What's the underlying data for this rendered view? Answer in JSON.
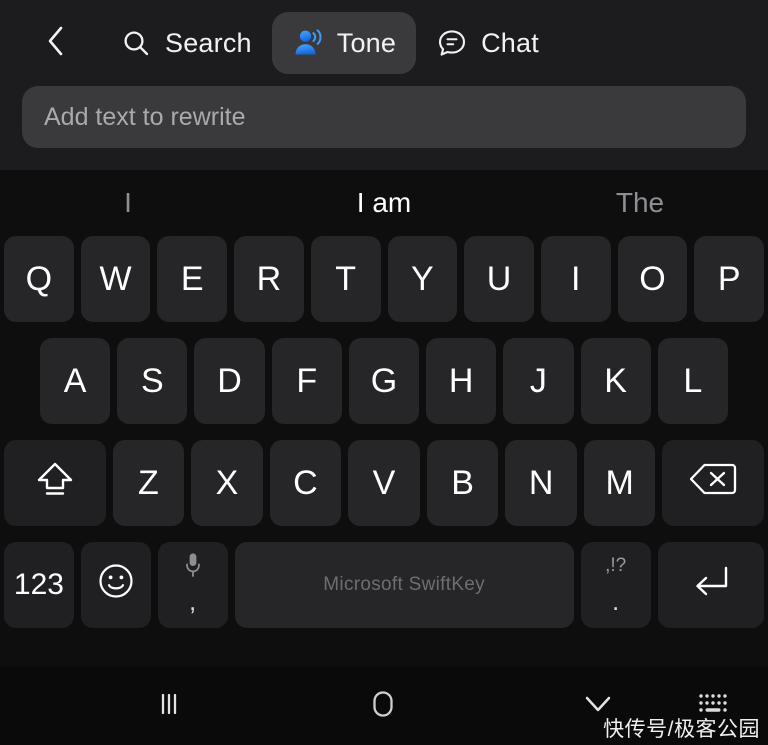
{
  "toolbar": {
    "back_icon": "chevron-left-icon",
    "items": [
      {
        "label": "Search",
        "icon": "search-icon",
        "active": false
      },
      {
        "label": "Tone",
        "icon": "tone-person-waves-icon",
        "active": true
      },
      {
        "label": "Chat",
        "icon": "chat-bubble-icon",
        "active": false
      }
    ]
  },
  "input": {
    "placeholder": "Add text to rewrite",
    "value": ""
  },
  "predictions": [
    {
      "text": "I",
      "emphasis": "dim"
    },
    {
      "text": "I am",
      "emphasis": "bright"
    },
    {
      "text": "The",
      "emphasis": "dim"
    }
  ],
  "keyboard": {
    "row1": [
      "Q",
      "W",
      "E",
      "R",
      "T",
      "Y",
      "U",
      "I",
      "O",
      "P"
    ],
    "row2": [
      "A",
      "S",
      "D",
      "F",
      "G",
      "H",
      "J",
      "K",
      "L"
    ],
    "row3": {
      "shift_icon": "shift-up-arrow-icon",
      "letters": [
        "Z",
        "X",
        "C",
        "V",
        "B",
        "N",
        "M"
      ],
      "backspace_icon": "backspace-delete-icon"
    },
    "row4": {
      "numeric_label": "123",
      "emoji_icon": "smiley-face-icon",
      "mic_icon": "microphone-icon",
      "mic_secondary": ",",
      "space_label": "Microsoft SwiftKey",
      "punct_top": ",!?",
      "punct_bottom": ".",
      "enter_icon": "enter-return-icon"
    }
  },
  "navbar": {
    "recents_icon": "recents-bars-icon",
    "home_icon": "home-square-icon",
    "dismiss_keyboard_icon": "chevron-down-icon",
    "keyboard_switch_icon": "keyboard-grid-icon"
  },
  "watermark": {
    "text": "快传号/极客公园"
  },
  "colors": {
    "toolbar_bg": "#1c1c1e",
    "keyboard_bg": "#0e0e0f",
    "key_bg": "#262628",
    "accent_blue": "#3b9bf5",
    "accent_blue_dark": "#1f6fd6",
    "active_chip": "#3a3a3c",
    "text_primary": "#ffffff",
    "text_muted": "#8e8e93"
  }
}
